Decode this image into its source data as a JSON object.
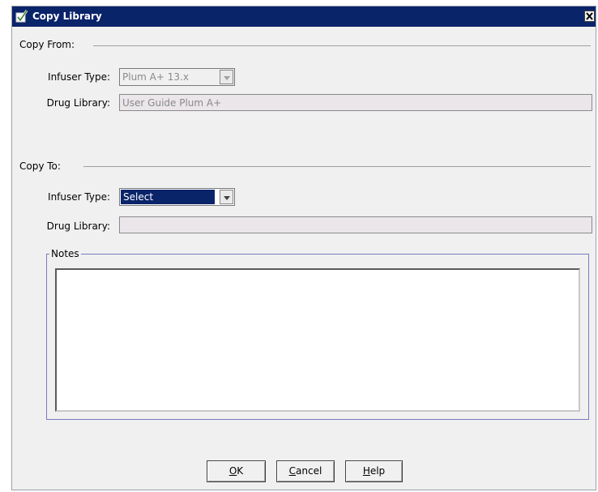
{
  "window": {
    "title": "Copy Library",
    "close_glyph": "✕"
  },
  "copy_from": {
    "section_label": "Copy From:",
    "infuser_label": "Infuser Type:",
    "infuser_value": "Plum A+ 13.x",
    "drug_library_label": "Drug Library:",
    "drug_library_value": "User Guide Plum A+"
  },
  "copy_to": {
    "section_label": "Copy To:",
    "infuser_label": "Infuser Type:",
    "infuser_value": "Select",
    "drug_library_label": "Drug Library:",
    "drug_library_value": ""
  },
  "notes": {
    "label": "Notes",
    "value": ""
  },
  "buttons": {
    "ok": {
      "mnemonic": "O",
      "rest": "K"
    },
    "cancel": {
      "mnemonic": "C",
      "rest": "ancel"
    },
    "help": {
      "mnemonic": "H",
      "rest": "elp"
    }
  },
  "colors": {
    "titlebar": "#0a246a",
    "selection": "#0a246a",
    "dialog_bg": "#f0f0f0",
    "notes_border": "#7a7ac0"
  },
  "icons": {
    "title": "app-icon",
    "close": "close-icon",
    "dropdown": "chevron-down-icon"
  }
}
